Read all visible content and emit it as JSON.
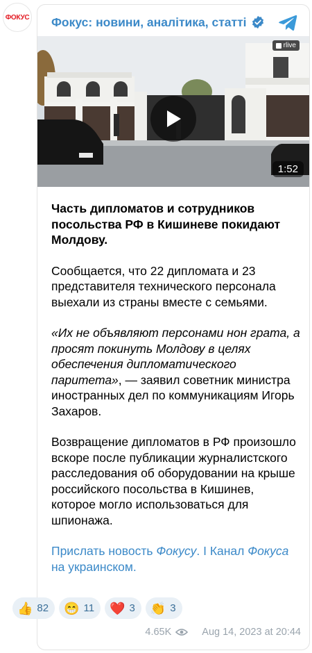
{
  "channel": {
    "avatar_text": "ФОКУС",
    "name": "Фокус: новини, аналітика, статті"
  },
  "video": {
    "duration": "1:52",
    "source_badge": "rlive"
  },
  "post": {
    "headline": "Часть дипломатов и сотрудников посольства РФ в Кишиневе покидают Молдову.",
    "p1": "Сообщается, что 22 дипломата и 23 представителя технического персонала выехали из страны вместе с семьями.",
    "quote": "«Их не объявляют персонами нон грата, а просят покинуть Молдову в целях обеспечения дипломатического паритета»",
    "p2_rest": ", — заявил советник министра иностранных дел по коммуникациям Игорь Захаров.",
    "p3": "Возвращение дипломатов в РФ произошло вскоре после публикации журналистского расследования об оборудовании на крыше российского посольства в Кишинев, которое могло использоваться для шпионажа.",
    "links": {
      "send_a": "Прислать новость ",
      "send_b": "Фокусу",
      "send_c": ".",
      "sep": " I ",
      "channel_a": "Канал ",
      "channel_b": "Фокуса",
      "channel_c": " на украинском."
    }
  },
  "reactions": [
    {
      "emoji": "👍",
      "count": "82"
    },
    {
      "emoji": "😁",
      "count": "11"
    },
    {
      "emoji": "❤️",
      "count": "3"
    },
    {
      "emoji": "👏",
      "count": "3"
    }
  ],
  "meta": {
    "views": "4.65K",
    "date": "Aug 14, 2023 at 20:44"
  },
  "colors": {
    "accent": "#3b89c8",
    "reaction_bg": "#e9f0f6"
  }
}
